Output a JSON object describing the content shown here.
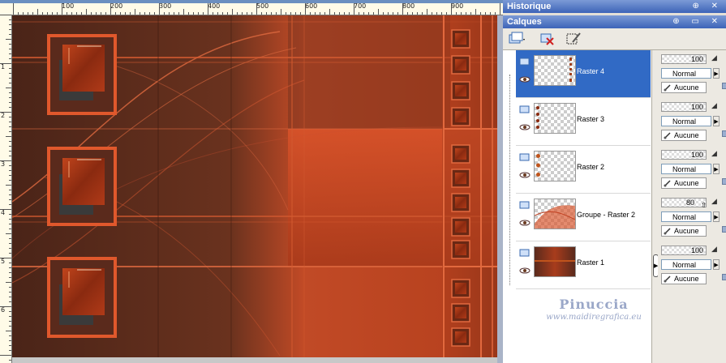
{
  "canvas": {
    "ruler_labels": [
      "100",
      "200",
      "300",
      "400",
      "500",
      "600",
      "700",
      "800",
      "900"
    ],
    "vertical_ruler_labels": [
      "1",
      "2",
      "3",
      "4",
      "5",
      "6"
    ],
    "frame_color": "#e0582c",
    "background_color": "#5a2f20"
  },
  "panels": {
    "historique": {
      "title": "Historique",
      "buttons": "⊕ ✕"
    },
    "calques": {
      "title": "Calques",
      "buttons": "⊕ ▭ ✕"
    }
  },
  "layers": [
    {
      "name": "Raster 4",
      "opacity": "100",
      "blend": "Normal",
      "mask": "Aucune",
      "selected": true,
      "thumb": "raster4"
    },
    {
      "name": "Raster 3",
      "opacity": "100",
      "blend": "Normal",
      "mask": "Aucune",
      "selected": false,
      "thumb": "raster3"
    },
    {
      "name": "Raster 2",
      "opacity": "100",
      "blend": "Normal",
      "mask": "Aucune",
      "selected": false,
      "thumb": "raster2"
    },
    {
      "name": "Groupe - Raster 2",
      "opacity": "80",
      "blend": "Normal",
      "mask": "Aucune",
      "selected": false,
      "thumb": "groupe"
    },
    {
      "name": "Raster 1",
      "opacity": "100",
      "blend": "Normal",
      "mask": "Aucune",
      "selected": false,
      "thumb": "raster1"
    }
  ],
  "watermark": {
    "name": "Pinuccia",
    "url": "www.maidiregrafica.eu"
  }
}
